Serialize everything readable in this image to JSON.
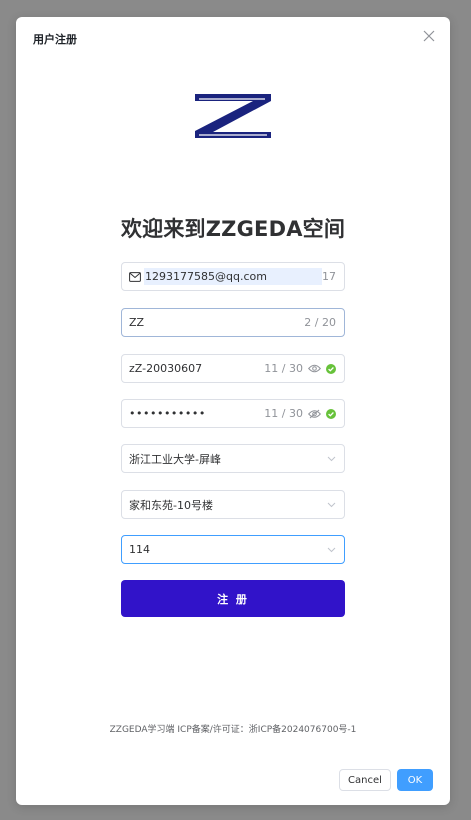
{
  "dialog": {
    "title": "用户注册",
    "close_icon": "close-icon"
  },
  "logo": {
    "text": "ZZ",
    "color": "#1a237e"
  },
  "welcome": "欢迎来到ZZGEDA空间",
  "form": {
    "email": {
      "icon": "mail-icon",
      "value": "1293177585@qq.com",
      "count": "17"
    },
    "username": {
      "value": "ZZ",
      "count": "2 / 20"
    },
    "password": {
      "value": "zZ-20030607",
      "count": "11 / 30",
      "visibility_icon": "eye-icon",
      "status_icon": "check-circle-icon"
    },
    "confirm_password": {
      "value": "•••••••••••",
      "count": "11 / 30",
      "visibility_icon": "eye-off-icon",
      "status_icon": "check-circle-icon"
    },
    "school": {
      "value": "浙江工业大学-屏峰"
    },
    "building": {
      "value": "家和东苑-10号楼"
    },
    "room": {
      "value": "114"
    },
    "submit_label": "注 册"
  },
  "footer": {
    "icp": "ZZGEDA学习端 ICP备案/许可证：浙ICP备2024076700号-1",
    "cancel_label": "Cancel",
    "ok_label": "OK"
  },
  "colors": {
    "primary": "#3113c9",
    "ok": "#409eff",
    "success": "#67c23a",
    "overlay": "#8a8a8a"
  }
}
